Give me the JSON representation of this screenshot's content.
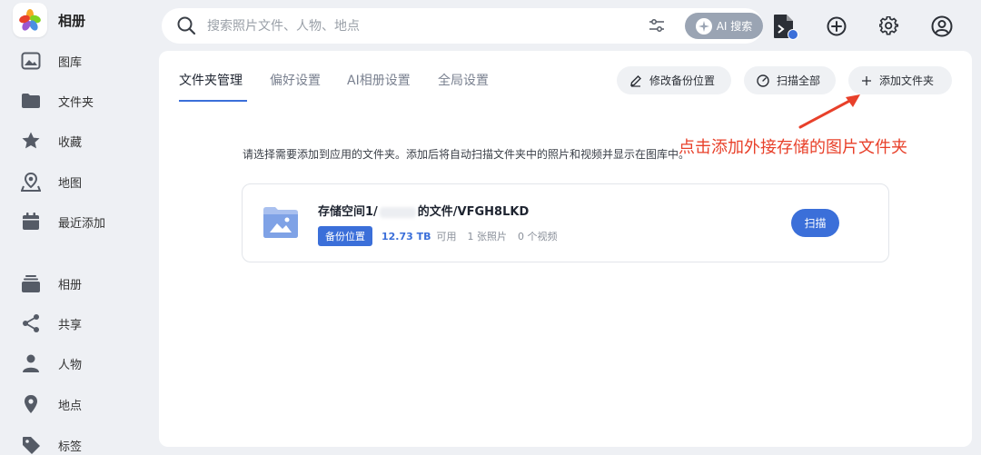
{
  "app": {
    "title": "相册"
  },
  "sidebar": {
    "items": [
      {
        "label": "图库",
        "icon": "photo-library-icon"
      },
      {
        "label": "文件夹",
        "icon": "folder-icon"
      },
      {
        "label": "收藏",
        "icon": "star-icon"
      },
      {
        "label": "地图",
        "icon": "map-pin-icon"
      },
      {
        "label": "最近添加",
        "icon": "calendar-icon"
      },
      {
        "label": "相册",
        "icon": "album-stack-icon"
      },
      {
        "label": "共享",
        "icon": "share-icon"
      },
      {
        "label": "人物",
        "icon": "person-icon"
      },
      {
        "label": "地点",
        "icon": "location-icon"
      },
      {
        "label": "标签",
        "icon": "tag-icon"
      }
    ]
  },
  "search": {
    "placeholder": "搜索照片文件、人物、地点",
    "ai_label": "AI 搜索"
  },
  "tabs": [
    {
      "label": "文件夹管理",
      "active": true
    },
    {
      "label": "偏好设置",
      "active": false
    },
    {
      "label": "AI相册设置",
      "active": false
    },
    {
      "label": "全局设置",
      "active": false
    }
  ],
  "actions": {
    "edit_backup": "修改备份位置",
    "scan_all": "扫描全部",
    "add_folder": "添加文件夹"
  },
  "annotation": {
    "text": "点击添加外接存储的图片文件夹"
  },
  "instruction": "请选择需要添加到应用的文件夹。添加后将自动扫描文件夹中的照片和视频并显示在图库中。",
  "folder": {
    "name_prefix": "存储空间1/",
    "name_suffix": "的文件/VFGH8LKD",
    "badge": "备份位置",
    "storage": "12.73 TB",
    "storage_suffix": "可用",
    "photos": "1 张照片",
    "videos": "0 个视频",
    "scan_label": "扫描"
  },
  "colors": {
    "accent": "#3b6fd9",
    "annotation": "#e8402a"
  }
}
